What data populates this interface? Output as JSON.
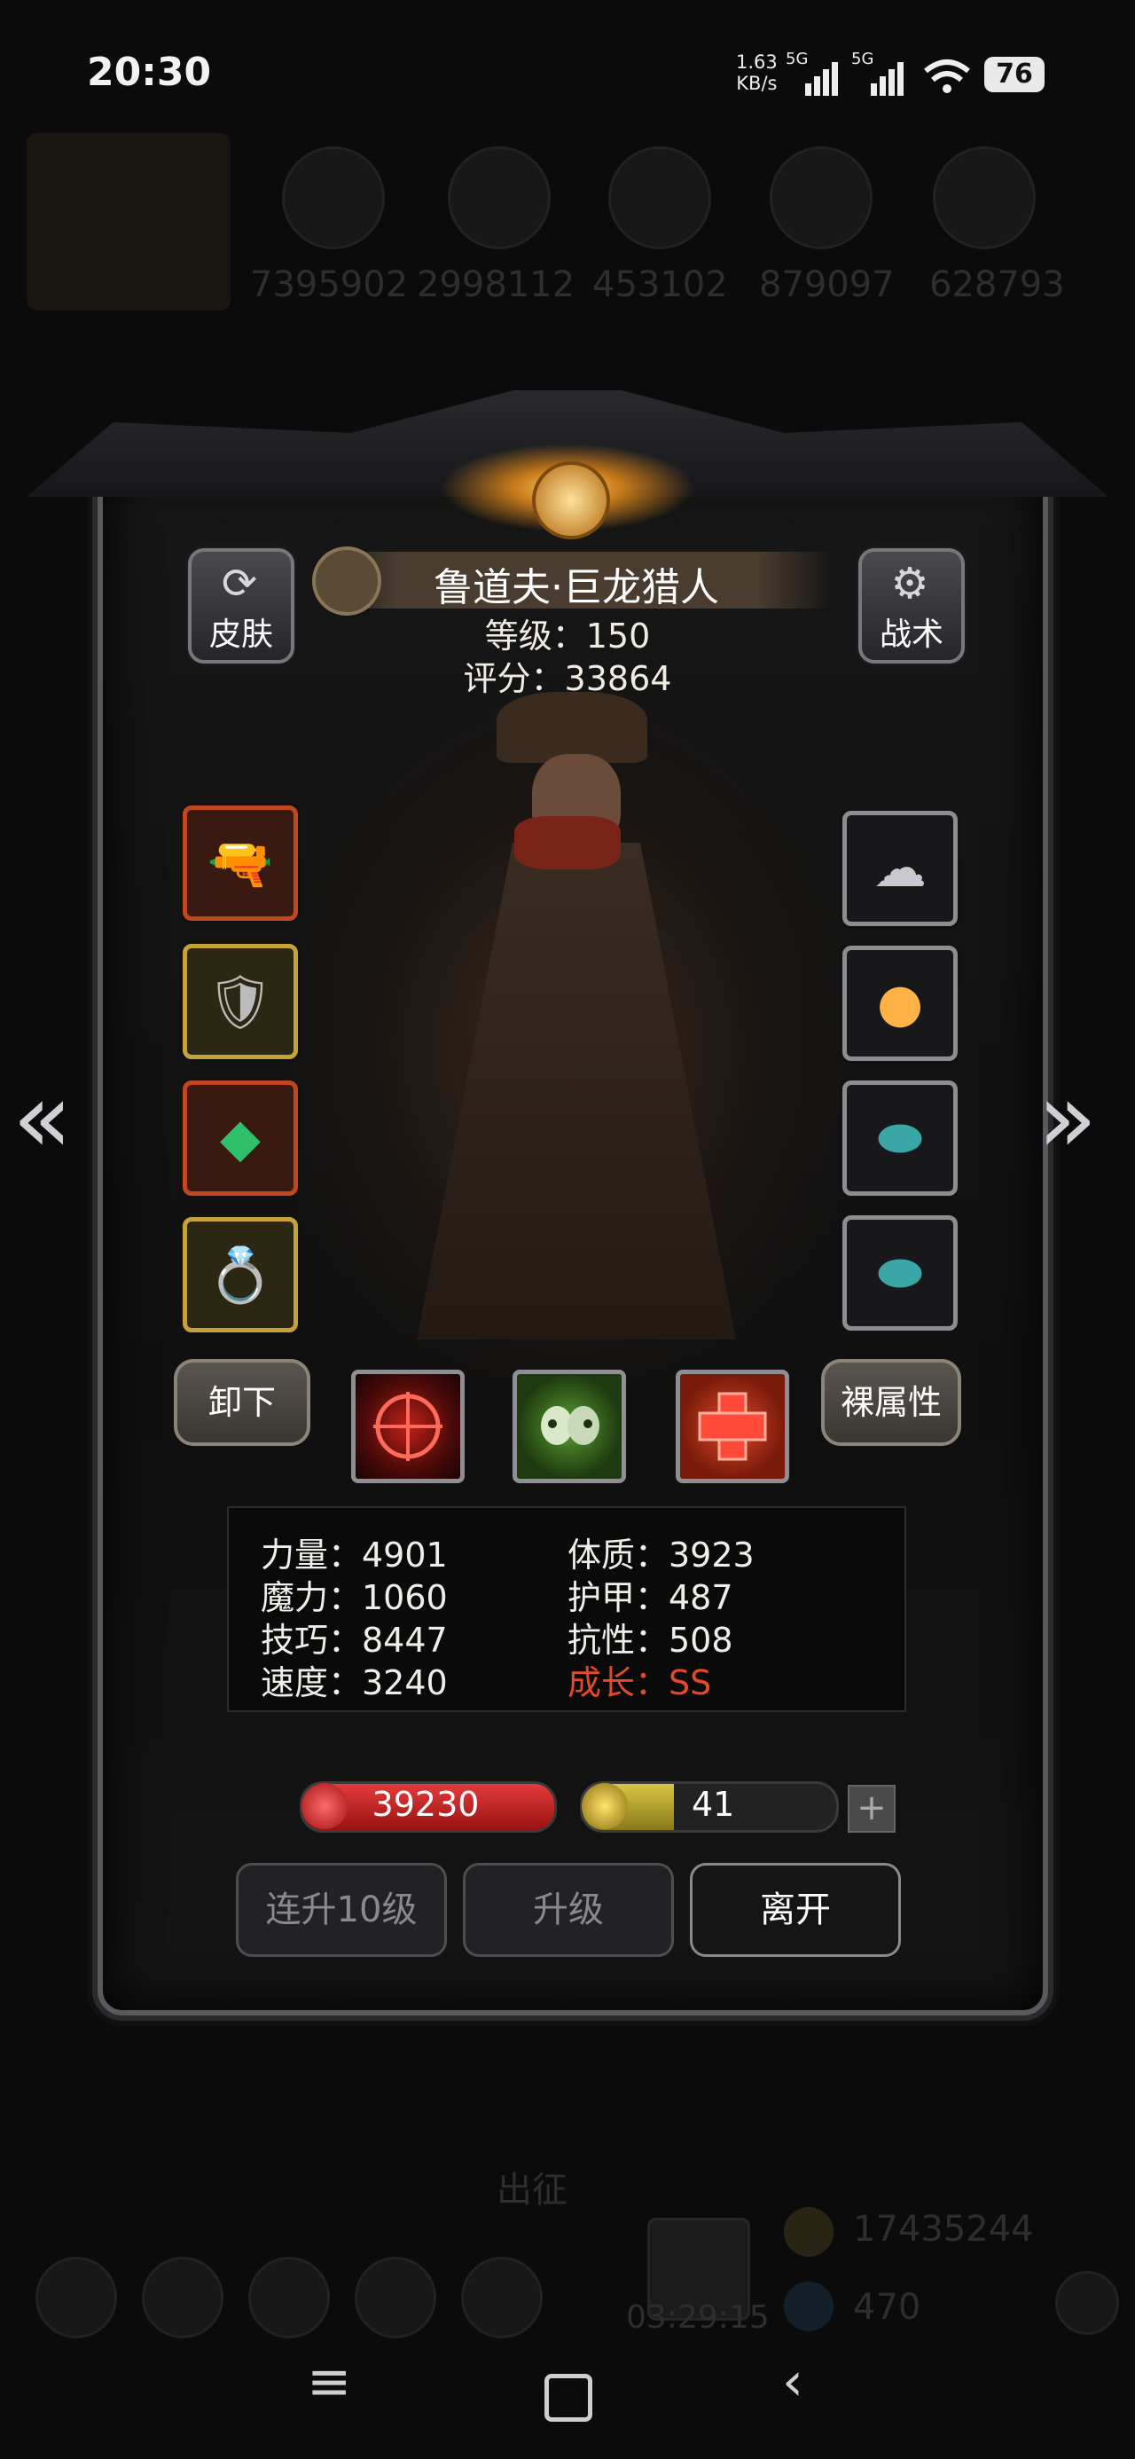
{
  "status_bar": {
    "time": "20:30",
    "net_speed_value": "1.63",
    "net_speed_unit": "KB/s",
    "sim1": "5G",
    "sim2": "5G",
    "battery": "76"
  },
  "background": {
    "resources": [
      "7395902",
      "2998112",
      "453102",
      "879097",
      "628793"
    ],
    "gold": "17435244",
    "gems": "470",
    "timer": "03:29:15",
    "expedition_label": "出征"
  },
  "hero": {
    "name": "鲁道夫·巨龙猎人",
    "level_label": "等级：150",
    "score_label": "评分：33864"
  },
  "buttons": {
    "skin": "皮肤",
    "tactics": "战术",
    "unequip": "卸下",
    "naked_attrs": "裸属性",
    "level_up_10": "连升10级",
    "level_up": "升级",
    "leave": "离开"
  },
  "stats": {
    "strength": "力量：4901",
    "constitution": "体质：3923",
    "magic": "魔力：1060",
    "armor": "护甲：487",
    "skill": "技巧：8447",
    "resistance": "抗性：508",
    "speed": "速度：3240",
    "growth": "成长：SS"
  },
  "bars": {
    "hp": "39230",
    "energy": "41",
    "energy_fill_fraction": 0.36
  },
  "equipment_left": [
    {
      "icon": "golden-gun-icon",
      "rarity": "orange"
    },
    {
      "icon": "armor-icon",
      "rarity": "gold"
    },
    {
      "icon": "emerald-amulet-icon",
      "rarity": "orange"
    },
    {
      "icon": "ring-icon",
      "rarity": "gold"
    }
  ],
  "equipment_right": [
    {
      "icon": "silver-cloud-charm-icon",
      "rarity": "gray"
    },
    {
      "icon": "fire-orb-icon",
      "rarity": "gray"
    },
    {
      "icon": "teal-stone-icon",
      "rarity": "gray"
    },
    {
      "icon": "teal-stone-icon",
      "rarity": "gray"
    }
  ],
  "colors": {
    "growth_red": "#e34a2a",
    "hp_red": "#d32f2f",
    "energy_yellow": "#d8c645"
  }
}
